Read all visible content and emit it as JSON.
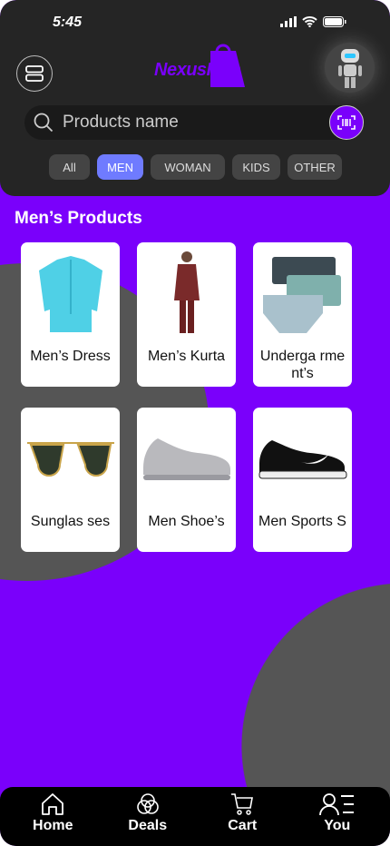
{
  "status_bar": {
    "time": "5:45"
  },
  "header": {
    "logo_text": "NexusHub",
    "search_placeholder": "Products name"
  },
  "categories": [
    {
      "label": "All",
      "active": false
    },
    {
      "label": "MEN",
      "active": true
    },
    {
      "label": "WOMAN",
      "active": false
    },
    {
      "label": "KIDS",
      "active": false
    },
    {
      "label": "OTHER",
      "active": false
    }
  ],
  "section_title": "Men’s Products",
  "products": [
    {
      "name": "Men’s Dress",
      "icon": "shirt"
    },
    {
      "name": "Men’s Kurta",
      "icon": "kurta"
    },
    {
      "name": "Underga rment’s",
      "icon": "underwear"
    },
    {
      "name": "Sunglas ses",
      "icon": "sunglasses"
    },
    {
      "name": "Men Shoe’s",
      "icon": "shoe"
    },
    {
      "name": "Men Sports S",
      "icon": "sports-shoe"
    }
  ],
  "nav": [
    {
      "label": "Home"
    },
    {
      "label": "Deals"
    },
    {
      "label": "Cart"
    },
    {
      "label": "You"
    }
  ],
  "colors": {
    "accent": "#7a00fb",
    "active_chip": "#6f7bff",
    "header": "#252525"
  }
}
